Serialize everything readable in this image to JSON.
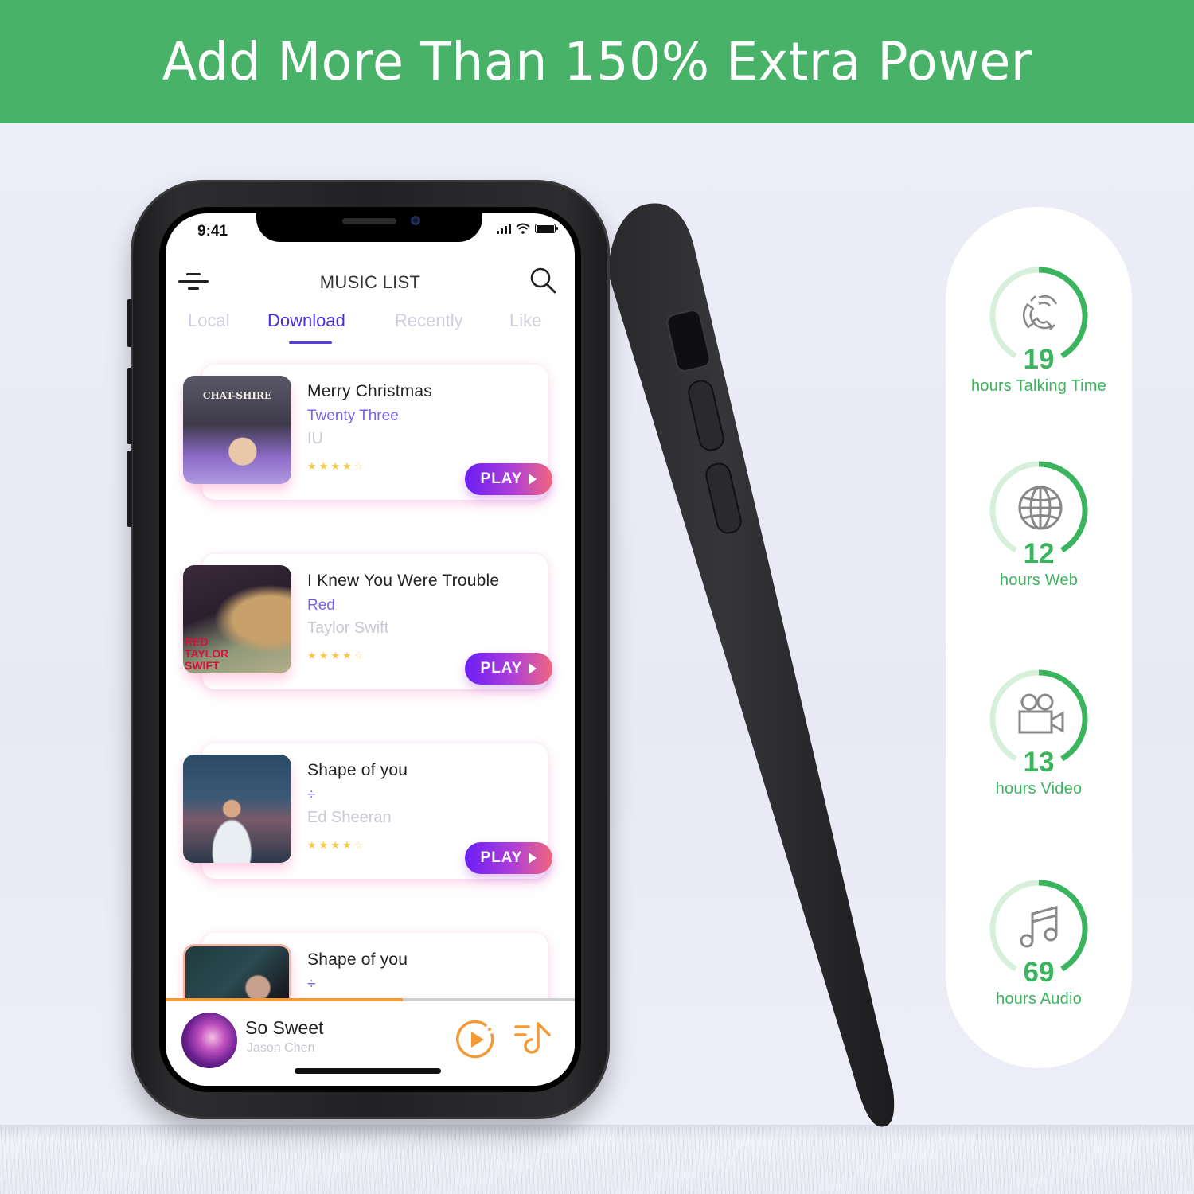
{
  "banner": {
    "headline": "Add More Than 150% Extra Power",
    "bg_color": "#47b268"
  },
  "phone": {
    "status_bar": {
      "time": "9:41"
    },
    "app": {
      "title": "MUSIC LIST",
      "icons": {
        "menu": "menu-icon",
        "search": "search-icon"
      },
      "tabs": [
        {
          "label": "Local",
          "active": false
        },
        {
          "label": "Download",
          "active": true
        },
        {
          "label": "Recently",
          "active": false
        },
        {
          "label": "Like",
          "active": false
        }
      ],
      "songs": [
        {
          "title": "Merry Christmas",
          "album": "Twenty Three",
          "artist": "IU",
          "rating": 4,
          "rating_max": 5,
          "play_label": "PLAY",
          "art_text": "CHAT-SHIRE"
        },
        {
          "title": "I Knew You Were Trouble",
          "album": "Red",
          "artist": "Taylor Swift",
          "rating": 4,
          "rating_max": 5,
          "play_label": "PLAY",
          "art_text": "RED TAYLOR SWIFT"
        },
        {
          "title": "Shape of you",
          "album": "÷",
          "artist": "Ed Sheeran",
          "rating": 4,
          "rating_max": 5,
          "play_label": "PLAY",
          "art_text": ""
        },
        {
          "title": "Shape of you",
          "album": "÷",
          "artist": "",
          "rating": null,
          "rating_max": 5,
          "play_label": "",
          "art_text": ""
        }
      ],
      "now_playing": {
        "title": "So Sweet",
        "artist": "Jason Chen",
        "progress_fraction": 0.58,
        "icons": {
          "play": "play-circle-icon",
          "playlist": "playlist-music-icon"
        }
      },
      "colors": {
        "accent": "#4a2ed8",
        "album_text": "#7a62ea",
        "player_accent": "#f39a36",
        "star": "#f7c842"
      }
    }
  },
  "stats": [
    {
      "value": "19",
      "label": "hours Talking Time",
      "icon": "phone-icon"
    },
    {
      "value": "12",
      "label": "hours Web",
      "icon": "globe-icon"
    },
    {
      "value": "13",
      "label": "hours Video",
      "icon": "video-camera-icon"
    },
    {
      "value": "69",
      "label": "hours Audio",
      "icon": "music-note-icon"
    }
  ],
  "stats_color": "#3bb45e"
}
